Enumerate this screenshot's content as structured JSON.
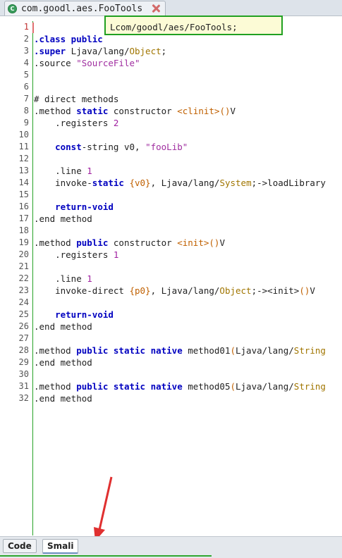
{
  "tab": {
    "title": "com.goodl.aes.FooTools",
    "icon": "class-c-icon"
  },
  "highlight": {
    "text": "Lcom/goodl/aes/FooTools;",
    "color": "#21a021"
  },
  "lines": [
    {
      "n": "1"
    },
    {
      "n": "2"
    },
    {
      "n": "3"
    },
    {
      "n": "4"
    },
    {
      "n": "5"
    },
    {
      "n": "6"
    },
    {
      "n": "7"
    },
    {
      "n": "8"
    },
    {
      "n": "9"
    },
    {
      "n": "10"
    },
    {
      "n": "11"
    },
    {
      "n": "12"
    },
    {
      "n": "13"
    },
    {
      "n": "14"
    },
    {
      "n": "15"
    },
    {
      "n": "16"
    },
    {
      "n": "17"
    },
    {
      "n": "18"
    },
    {
      "n": "19"
    },
    {
      "n": "20"
    },
    {
      "n": "21"
    },
    {
      "n": "22"
    },
    {
      "n": "23"
    },
    {
      "n": "24"
    },
    {
      "n": "25"
    },
    {
      "n": "26"
    },
    {
      "n": "27"
    },
    {
      "n": "28"
    },
    {
      "n": "29"
    },
    {
      "n": "30"
    },
    {
      "n": "31"
    },
    {
      "n": "32"
    }
  ],
  "code": {
    "l1": ".class public ",
    "l2a": ".super",
    "l2b": " Ljava/lang/",
    "l2c": "Object",
    "l2d": ";",
    "l3a": ".source ",
    "l3b": "\"SourceFile\"",
    "l6": "# direct methods",
    "l7a": ".method ",
    "l7b": "static",
    "l7c": " constructor ",
    "l7d": "<clinit>",
    "l7e": "()",
    "l7f": "V",
    "l8a": "    .registers ",
    "l8b": "2",
    "l10a": "    ",
    "l10b": "const",
    "l10c": "-string v0, ",
    "l10d": "\"fooLib\"",
    "l12a": "    .line ",
    "l12b": "1",
    "l13a": "    invoke-",
    "l13b": "static",
    "l13c": " ",
    "l13d": "{v0}",
    "l13e": ", Ljava/lang/",
    "l13f": "System",
    "l13g": ";->loadLibrary",
    "l15a": "    ",
    "l15b": "return-void",
    "l16": ".end method",
    "l18a": ".method ",
    "l18b": "public",
    "l18c": " constructor ",
    "l18d": "<init>",
    "l18e": "()",
    "l18f": "V",
    "l19a": "    .registers ",
    "l19b": "1",
    "l21a": "    .line ",
    "l21b": "1",
    "l22a": "    invoke-direct ",
    "l22b": "{p0}",
    "l22c": ", Ljava/lang/",
    "l22d": "Object",
    "l22e": ";-><init>",
    "l22f": "()",
    "l22g": "V",
    "l24a": "    ",
    "l24b": "return-void",
    "l25": ".end method",
    "l27a": ".method ",
    "l27b": "public static native",
    "l27c": " method01",
    "l27d": "(",
    "l27e": "Ljava/lang/",
    "l27f": "String",
    "l28": ".end method",
    "l30a": ".method ",
    "l30b": "public static native",
    "l30c": " method05",
    "l30d": "(",
    "l30e": "Ljava/lang/",
    "l30f": "String",
    "l31": ".end method"
  },
  "bottom_tabs": {
    "code": "Code",
    "smali": "Smali",
    "active": "Smali"
  },
  "colors": {
    "keyword": "#0000c0",
    "string": "#a02ea0",
    "type": "#a07500",
    "annotation_arrow": "#e03030"
  }
}
